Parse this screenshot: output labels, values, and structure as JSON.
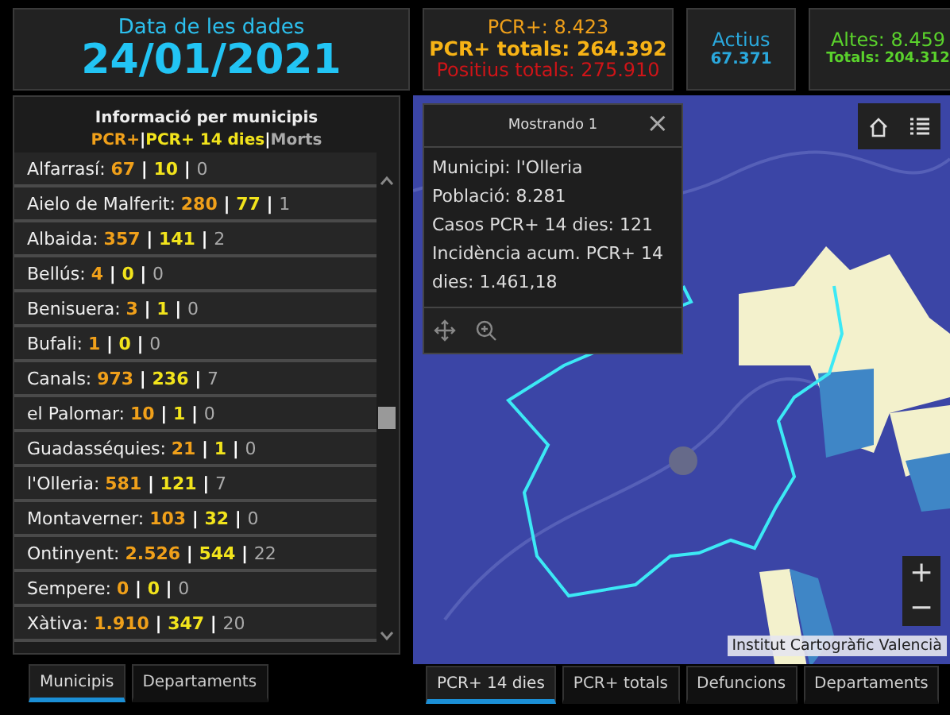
{
  "header_cards": [
    {
      "lines": [
        {
          "text": "Data de les dades",
          "kind": "label"
        },
        {
          "text": "24/01/2021",
          "kind": "date"
        }
      ]
    },
    {
      "lines": [
        {
          "text": "PCR+: 8.423",
          "kind": "pcr"
        },
        {
          "text": "PCR+ totals: 264.392",
          "kind": "pcr_total"
        },
        {
          "text": "Positius totals: 275.910",
          "kind": "positius"
        }
      ]
    },
    {
      "lines": [
        {
          "text": "Actius",
          "kind": "actius"
        },
        {
          "text": "67.371",
          "kind": "actius_value"
        }
      ]
    },
    {
      "lines": [
        {
          "text": "Altes: 8.459",
          "kind": "altes"
        },
        {
          "text": "Totals: 204.312",
          "kind": "altes_total"
        }
      ]
    }
  ],
  "panel": {
    "title": "Informació per municipis",
    "separator": "|",
    "legend": [
      {
        "text": "PCR+",
        "kind": "pcr"
      },
      {
        "text": "PCR+ 14 dies",
        "kind": "pcr_14"
      },
      {
        "text": "Morts",
        "kind": "morts"
      }
    ],
    "rows": [
      {
        "label": "Alfarrasí:",
        "pcr": "67",
        "pcr_14": "10",
        "morts": "0"
      },
      {
        "label": "Aielo de Malferit:",
        "pcr": "280",
        "pcr_14": "77",
        "morts": "1"
      },
      {
        "label": "Albaida:",
        "pcr": "357",
        "pcr_14": "141",
        "morts": "2"
      },
      {
        "label": "Bellús:",
        "pcr": "4",
        "pcr_14": "0",
        "morts": "0"
      },
      {
        "label": "Benisuera:",
        "pcr": "3",
        "pcr_14": "1",
        "morts": "0"
      },
      {
        "label": "Bufali:",
        "pcr": "1",
        "pcr_14": "0",
        "morts": "0"
      },
      {
        "label": "Canals:",
        "pcr": "973",
        "pcr_14": "236",
        "morts": "7"
      },
      {
        "label": "el Palomar:",
        "pcr": "10",
        "pcr_14": "1",
        "morts": "0"
      },
      {
        "label": "Guadasséquies:",
        "pcr": "21",
        "pcr_14": "1",
        "morts": "0"
      },
      {
        "label": "l'Olleria:",
        "pcr": "581",
        "pcr_14": "121",
        "morts": "7"
      },
      {
        "label": "Montaverner:",
        "pcr": "103",
        "pcr_14": "32",
        "morts": "0"
      },
      {
        "label": "Ontinyent:",
        "pcr": "2.526",
        "pcr_14": "544",
        "morts": "22"
      },
      {
        "label": "Sempere:",
        "pcr": "0",
        "pcr_14": "0",
        "morts": "0"
      },
      {
        "label": "Xàtiva:",
        "pcr": "1.910",
        "pcr_14": "347",
        "morts": "20"
      }
    ]
  },
  "left_tabs": [
    {
      "label": "Municipis",
      "selected": true
    },
    {
      "label": "Departaments",
      "selected": false
    }
  ],
  "map": {
    "popup": {
      "title": "Mostrando 1",
      "close": "×",
      "lines": [
        "Municipi: l'Olleria",
        "Població: 8.281",
        "Casos PCR+ 14 dies: 121",
        "Incidència acum. PCR+ 14 dies: 1.461,18"
      ]
    },
    "zoom_in": "+",
    "zoom_out": "−",
    "attribution": "Institut Cartogràfic Valencià"
  },
  "map_tabs": [
    {
      "label": "PCR+ 14 dies",
      "selected": true
    },
    {
      "label": "PCR+ totals",
      "selected": false
    },
    {
      "label": "Defuncions",
      "selected": false
    },
    {
      "label": "Departaments",
      "selected": false
    }
  ]
}
